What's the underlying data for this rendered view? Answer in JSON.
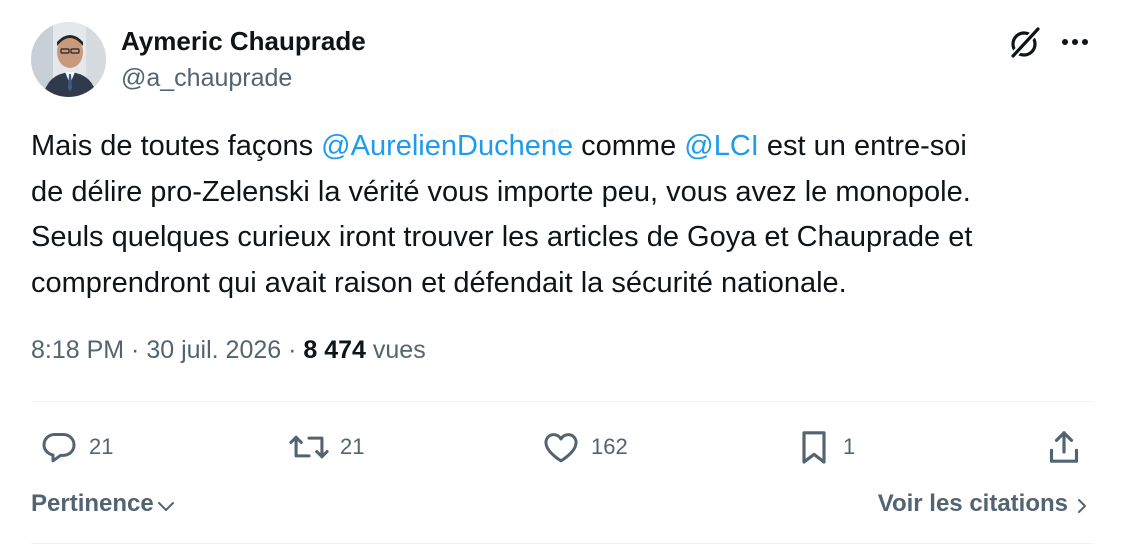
{
  "author": {
    "display_name": "Aymeric Chauprade",
    "handle": "@a_chauprade"
  },
  "tweet": {
    "lines": [
      [
        {
          "text": "Mais de toutes façons ",
          "type": "text"
        },
        {
          "text": "@AurelienDuchene",
          "type": "mention"
        },
        {
          "text": " comme ",
          "type": "text"
        },
        {
          "text": "@LCI",
          "type": "mention"
        },
        {
          "text": " est un entre-soi",
          "type": "text"
        }
      ],
      [
        {
          "text": "de délire pro-Zelenski la vérité vous importe peu, vous avez le monopole.",
          "type": "text"
        }
      ],
      [
        {
          "text": "Seuls quelques curieux iront trouver les articles de Goya et Chauprade et",
          "type": "text"
        }
      ],
      [
        {
          "text": "comprendront qui avait raison et défendait la sécurité nationale.",
          "type": "text"
        }
      ]
    ]
  },
  "meta": {
    "time": "8:18 PM",
    "separator": " · ",
    "date": "30 juil. 2026",
    "views_count": "8 474",
    "views_label": " vues"
  },
  "actions": {
    "replies": "21",
    "retweets": "21",
    "likes": "162",
    "bookmarks": "1"
  },
  "footer": {
    "sort_label": "Pertinence",
    "quotes_label": "Voir les citations"
  },
  "icons": {
    "grok": "grok-icon",
    "more": "more-dots-icon",
    "reply": "reply-bubble-icon",
    "retweet": "retweet-arrows-icon",
    "like": "heart-icon",
    "bookmark": "bookmark-icon",
    "share": "share-upload-icon",
    "sort": "chevron-down-icon",
    "quotes": "chevron-right-icon"
  },
  "colors": {
    "text_primary": "#0f1419",
    "text_secondary": "#536471",
    "link": "#1d9bf0",
    "divider": "#eff3f4"
  }
}
